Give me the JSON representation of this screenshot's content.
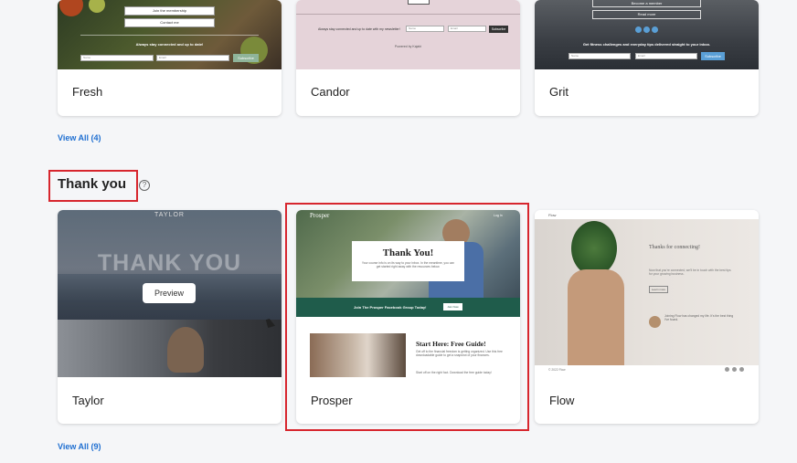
{
  "top_row": {
    "fresh": {
      "name": "Fresh",
      "buttons": [
        "Join the membership",
        "Contact me"
      ],
      "caption": "Always stay connected and up to date!",
      "name_placeholder": "Name",
      "email_placeholder": "Email",
      "subscribe": "Subscribe"
    },
    "candor": {
      "name": "Candor",
      "caption": "Always stay connected and up to date with my newsletter!",
      "name_placeholder": "Name",
      "email_placeholder": "Email",
      "subscribe": "Subscribe",
      "powered": "Powered by Kajabi"
    },
    "grit": {
      "name": "Grit",
      "buttons": [
        "Become a member",
        "Read more"
      ],
      "caption": "Get fitness challenges and everyday tips delivered straight to your inbox.",
      "name_placeholder": "Name",
      "email_placeholder": "Email",
      "subscribe": "Subscribe"
    },
    "view_all": "View All (4)"
  },
  "thank_you": {
    "title": "Thank you",
    "help": "?",
    "view_all": "View All (9)",
    "taylor": {
      "name": "Taylor",
      "logo": "TAYLOR",
      "headline": "THANK YOU",
      "preview": "Preview"
    },
    "prosper": {
      "name": "Prosper",
      "logo": "Prosper",
      "login": "Log In",
      "headline": "Thank You!",
      "body": "Your course info is on its way to your inbox. In the meantime, you can get started right away with the resources below.",
      "banner": "Join The Prosper Facebook Group Today!",
      "banner_btn": "Join Now",
      "guide_title": "Start Here: Free Guide!",
      "guide_body": "Get off to the financial freedom is getting organized. Use this free downloadable guide to get a snapshot of your finances.",
      "guide_cta": "Start off on the right foot. Download the free guide today!"
    },
    "flow": {
      "name": "Flow",
      "logo": "Flow",
      "headline": "Thanks for connecting!",
      "body": "Now that you're connected, we'll be in touch with the best tips for your growing business.",
      "button": "Learn more",
      "quote": "Joining Flow has changed my life. It's the best thing I've found.",
      "footer": "© 2022 Flow"
    }
  }
}
